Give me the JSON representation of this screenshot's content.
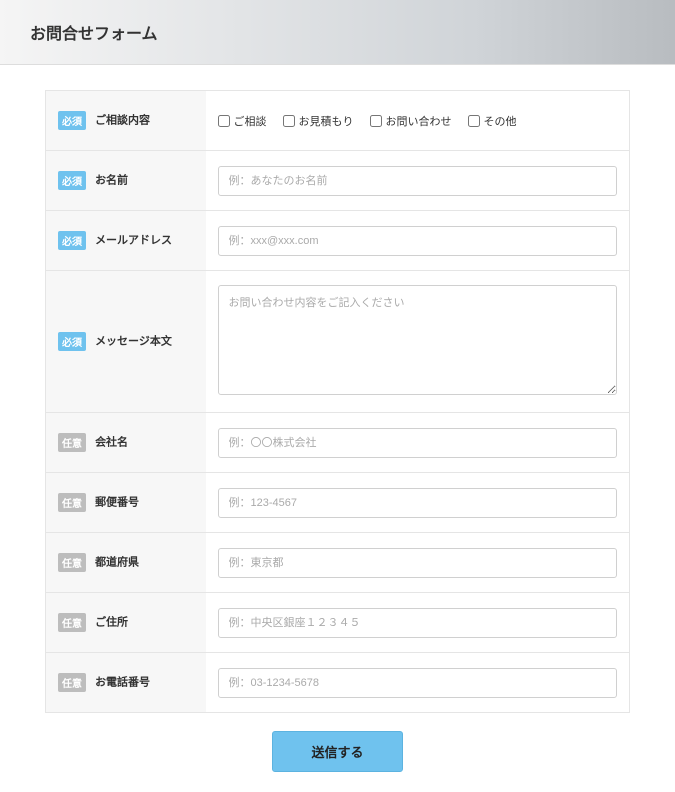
{
  "title": "お問合せフォーム",
  "badges": {
    "required": "必須",
    "optional": "任意"
  },
  "fields": {
    "topic": {
      "label": "ご相談内容",
      "options": [
        "ご相談",
        "お見積もり",
        "お問い合わせ",
        "その他"
      ]
    },
    "name": {
      "label": "お名前",
      "placeholder": "例：あなたのお名前"
    },
    "email": {
      "label": "メールアドレス",
      "placeholder": "例：xxx@xxx.com"
    },
    "message": {
      "label": "メッセージ本文",
      "placeholder": "お問い合わせ内容をご記入ください"
    },
    "company": {
      "label": "会社名",
      "placeholder": "例：〇〇株式会社"
    },
    "postal": {
      "label": "郵便番号",
      "placeholder": "例：123-4567"
    },
    "prefecture": {
      "label": "都道府県",
      "placeholder": "例：東京都"
    },
    "address": {
      "label": "ご住所",
      "placeholder": "例：中央区銀座１２３４５"
    },
    "phone": {
      "label": "お電話番号",
      "placeholder": "例：03-1234-5678"
    }
  },
  "submit_label": "送信する"
}
